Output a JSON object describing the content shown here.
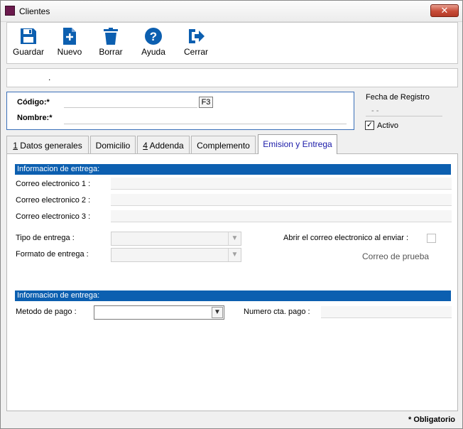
{
  "window": {
    "title": "Clientes",
    "close_label": "✕"
  },
  "toolbar": {
    "guardar": "Guardar",
    "nuevo": "Nuevo",
    "borrar": "Borrar",
    "ayuda": "Ayuda",
    "cerrar": "Cerrar"
  },
  "idbar": {
    "text": "."
  },
  "cliente": {
    "codigo_label": "Código:*",
    "nombre_label": "Nombre:*",
    "f3_label": "F3",
    "codigo_value": "",
    "nombre_value": ""
  },
  "registro": {
    "fecha_label": "Fecha de Registro",
    "fecha_value": "- -",
    "activo_label": "Activo",
    "activo_checked": "✓"
  },
  "tabs": [
    {
      "prefix": "1",
      "label": " Datos generales"
    },
    {
      "prefix": "",
      "label": "Domicilio"
    },
    {
      "prefix": "4",
      "label": " Addenda"
    },
    {
      "prefix": "",
      "label": "Complemento"
    },
    {
      "prefix": "",
      "label": "Emision y Entrega"
    }
  ],
  "entrega": {
    "section_title": "Informacion de entrega:",
    "correo1_label": "Correo electronico 1 :",
    "correo2_label": "Correo electronico 2 :",
    "correo3_label": "Correo electronico 3 :",
    "tipo_label": "Tipo de entrega :",
    "formato_label": "Formato de entrega :",
    "abrir_label": "Abrir el correo electronico al enviar :",
    "prueba_label": "Correo de prueba"
  },
  "pago": {
    "section_title": "Informacion de entrega:",
    "metodo_label": "Metodo de pago :",
    "numero_label": "Numero cta. pago :"
  },
  "footer": {
    "obligatorio": "* Obligatorio"
  }
}
